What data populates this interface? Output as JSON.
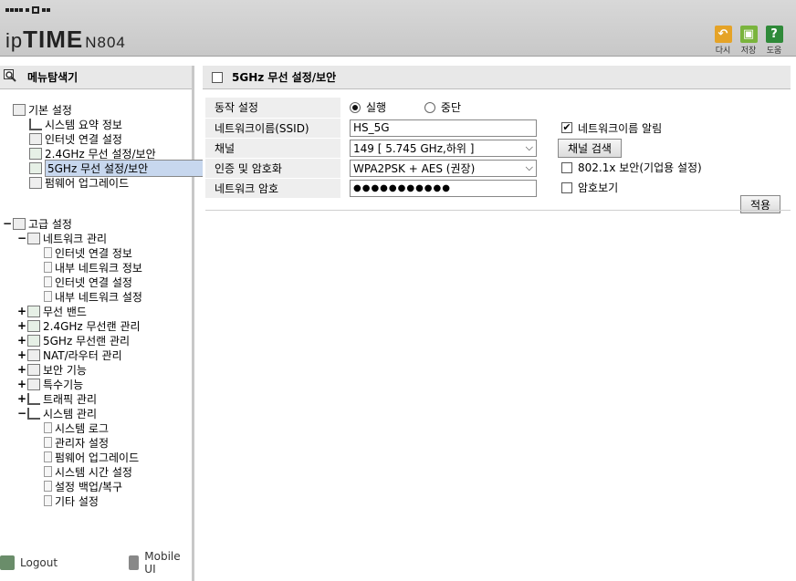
{
  "header": {
    "brand_prefix": "ip",
    "brand_bold": "TIME",
    "model": "N804",
    "tools": [
      {
        "label": "다시",
        "icon": "refresh-icon",
        "color": "#e5a327",
        "glyph": "↶"
      },
      {
        "label": "저장",
        "icon": "save-icon",
        "color": "#7ab43d",
        "glyph": "▣"
      },
      {
        "label": "도움",
        "icon": "help-icon",
        "color": "#2f8a39",
        "glyph": "?"
      }
    ]
  },
  "sidebar": {
    "title": "메뉴탐색기",
    "basic": {
      "label": "기본 설정",
      "items": [
        "시스템 요약 정보",
        "인터넷 연결 설정",
        "2.4GHz 무선 설정/보안",
        "5GHz 무선 설정/보안",
        "펌웨어 업그레이드"
      ]
    },
    "advanced": {
      "toggle": "−",
      "label": "고급 설정",
      "network": {
        "toggle": "−",
        "label": "네트워크 관리",
        "items": [
          "인터넷 연결 정보",
          "내부 네트워크 정보",
          "인터넷 연결 설정",
          "내부 네트워크 설정"
        ]
      },
      "groups": [
        {
          "toggle": "+",
          "label": "무선 밴드"
        },
        {
          "toggle": "+",
          "label": "2.4GHz 무선랜 관리"
        },
        {
          "toggle": "+",
          "label": "5GHz 무선랜 관리"
        },
        {
          "toggle": "+",
          "label": "NAT/라우터 관리"
        },
        {
          "toggle": "+",
          "label": "보안 기능"
        },
        {
          "toggle": "+",
          "label": "특수기능"
        },
        {
          "toggle": "+",
          "label": "트래픽 관리"
        }
      ],
      "system": {
        "toggle": "−",
        "label": "시스템 관리",
        "items": [
          "시스템 로그",
          "관리자 설정",
          "펌웨어 업그레이드",
          "시스템 시간 설정",
          "설정 백업/복구",
          "기타 설정"
        ]
      }
    },
    "logout": "Logout",
    "mobile": "Mobile UI"
  },
  "main": {
    "title": "5GHz 무선 설정/보안",
    "rows": {
      "operation": {
        "label": "동작 설정",
        "opt_on": "실행",
        "opt_off": "중단"
      },
      "ssid": {
        "label": "네트워크이름(SSID)",
        "value": "HS_5G",
        "broadcast_label": "네트워크이름 알림"
      },
      "channel": {
        "label": "채널",
        "value": "149 [ 5.745 GHz,하위 ]",
        "search_btn": "채널 검색"
      },
      "auth": {
        "label": "인증 및 암호화",
        "value": "WPA2PSK + AES (권장)",
        "enterprise_label": "802.1x 보안(기업용 설정)"
      },
      "password": {
        "label": "네트워크 암호",
        "value": "●●●●●●●●●●●",
        "show_label": "암호보기"
      }
    },
    "apply_btn": "적용"
  }
}
